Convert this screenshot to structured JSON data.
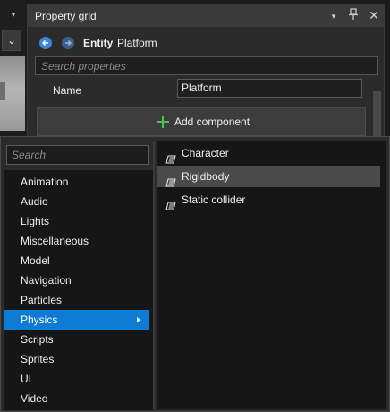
{
  "left_strip": {
    "menu_glyph": "▾",
    "dropdown_glyph": "⌄"
  },
  "panel": {
    "title": "Property grid",
    "header_icons": {
      "dropdown": "▾",
      "pin": "pin-icon",
      "close": "✕"
    },
    "entity_label": "Entity",
    "entity_name": "Platform",
    "search_placeholder": "Search properties",
    "name_label": "Name",
    "name_value": "Platform",
    "add_component_label": "Add component",
    "colors": {
      "accent": "#0e7bd4",
      "add_icon": "#4fc44f"
    }
  },
  "popup": {
    "search_placeholder": "Search",
    "categories": [
      {
        "label": "Animation"
      },
      {
        "label": "Audio"
      },
      {
        "label": "Lights"
      },
      {
        "label": "Miscellaneous"
      },
      {
        "label": "Model"
      },
      {
        "label": "Navigation"
      },
      {
        "label": "Particles"
      },
      {
        "label": "Physics"
      },
      {
        "label": "Scripts"
      },
      {
        "label": "Sprites"
      },
      {
        "label": "UI"
      },
      {
        "label": "Video"
      }
    ],
    "selected_category": "Physics",
    "components": [
      {
        "label": "Character",
        "icon": "component-icon"
      },
      {
        "label": "Rigidbody",
        "icon": "component-icon"
      },
      {
        "label": "Static collider",
        "icon": "component-icon"
      }
    ],
    "highlighted_component": "Rigidbody"
  }
}
